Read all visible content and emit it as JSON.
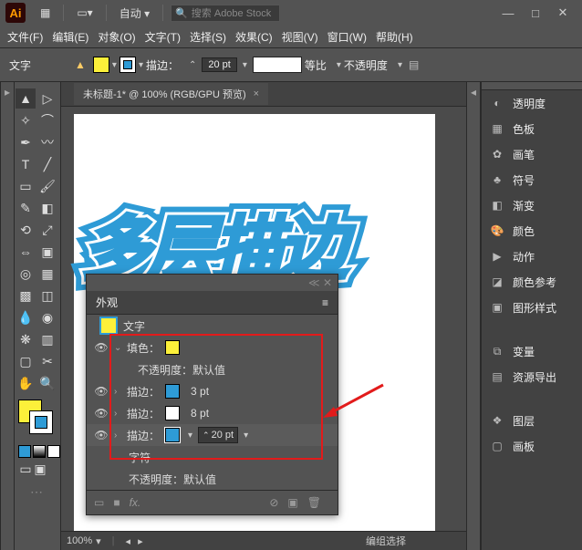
{
  "titlebar": {
    "layout_label": "自动",
    "search_placeholder": "搜索 Adobe Stock"
  },
  "menu": [
    "文件(F)",
    "编辑(E)",
    "对象(O)",
    "文字(T)",
    "选择(S)",
    "效果(C)",
    "视图(V)",
    "窗口(W)",
    "帮助(H)"
  ],
  "controlbar": {
    "mode": "文字",
    "stroke_label": "描边：",
    "stroke_pt": "20 pt",
    "ratio": "等比",
    "opacity_label": "不透明度"
  },
  "document": {
    "tab_title": "未标题-1* @ 100% (RGB/GPU 预览)",
    "artwork_text": "多层描边",
    "zoom": "100%",
    "status": "编组选择"
  },
  "appearance_panel": {
    "title": "外观",
    "type_label": "文字",
    "fill_label": "填色：",
    "opacity_label": "不透明度：",
    "opacity_value": "默认值",
    "stroke_label": "描边：",
    "stroke1_pt": "3 pt",
    "stroke2_pt": "8 pt",
    "stroke3_pt": "20 pt",
    "char_label": "字符",
    "bottom_opacity_label": "不透明度：",
    "bottom_opacity_value": "默认值"
  },
  "right_panels": {
    "items1": [
      "透明度",
      "色板",
      "画笔",
      "符号",
      "渐变",
      "颜色",
      "动作",
      "颜色参考",
      "图形样式"
    ],
    "items2": [
      "变量",
      "资源导出"
    ],
    "items3": [
      "图层",
      "画板"
    ]
  },
  "colors": {
    "yellow": "#fcf03a",
    "blue": "#2e9bd6",
    "white": "#ffffff"
  }
}
